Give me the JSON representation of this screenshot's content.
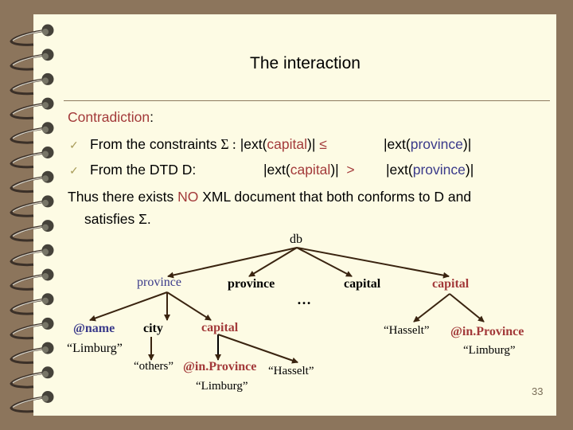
{
  "slide": {
    "title": "The interaction",
    "page_number": "33"
  },
  "body": {
    "heading": "Contradiction",
    "heading_colon": ":",
    "bullets": [
      {
        "icon": "checkmark-icon",
        "lead": "From the constraints",
        "sigma": "Σ :",
        "left_open": "|ext(",
        "left_elem": "capital",
        "left_close": ")|",
        "operator": "≤",
        "right_open": "|ext(",
        "right_elem": "province",
        "right_close": ")|"
      },
      {
        "icon": "checkmark-icon",
        "lead": "From the DTD D:",
        "left_open": "|ext(",
        "left_elem": "capital",
        "left_close": ")|",
        "operator": ">",
        "right_open": "|ext(",
        "right_elem": "province",
        "right_close": ")|"
      }
    ],
    "conclusion": {
      "part1": "Thus there exists ",
      "emph": "NO",
      "part2": " XML document that both conforms to D and",
      "line2": "satisfies Σ."
    }
  },
  "tree": {
    "root": "db",
    "ellipsis": "…",
    "nodes": {
      "province_1": "province",
      "province_2": "province",
      "capital_1": "capital",
      "capital_2": "capital",
      "at_name": "@name",
      "at_name_value": "“Limburg”",
      "city": "city",
      "city_value": "“others”",
      "capital_sub": "capital",
      "inprovince_1": "@in.Province",
      "inprovince_1_value": "“Limburg”",
      "capital_sub_value": "“Hasselt”",
      "capital_2_value": "“Hasselt”",
      "inprovince_2": "@in.Province",
      "inprovince_2_value": "“Limburg”"
    }
  },
  "colors": {
    "background": "#8c755c",
    "paper": "#fdfbe4",
    "red": "#a33a3a",
    "blue": "#3a3a8a",
    "check": "#a89c5a",
    "edge": "#3a2410"
  }
}
